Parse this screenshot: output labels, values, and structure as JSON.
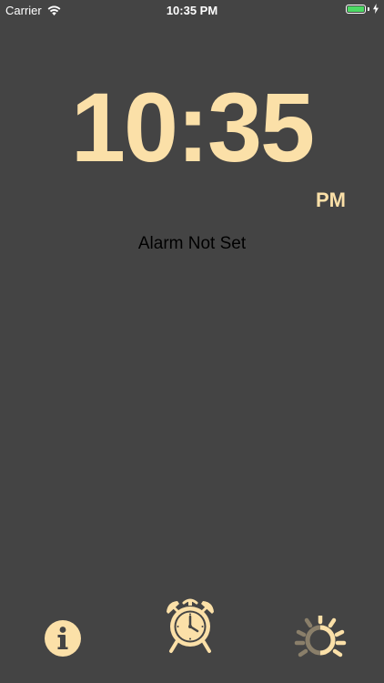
{
  "status_bar": {
    "carrier": "Carrier",
    "time": "10:35 PM",
    "battery_color": "#4cd964"
  },
  "clock": {
    "time": "10:35",
    "period": "PM",
    "color": "#fbe0a8"
  },
  "alarm": {
    "status": "Alarm Not Set"
  },
  "toolbar": {
    "items": [
      {
        "icon": "info-icon"
      },
      {
        "icon": "alarm-clock-icon"
      },
      {
        "icon": "brightness-icon"
      }
    ]
  },
  "colors": {
    "background": "#444444",
    "accent": "#fbe0a8"
  }
}
